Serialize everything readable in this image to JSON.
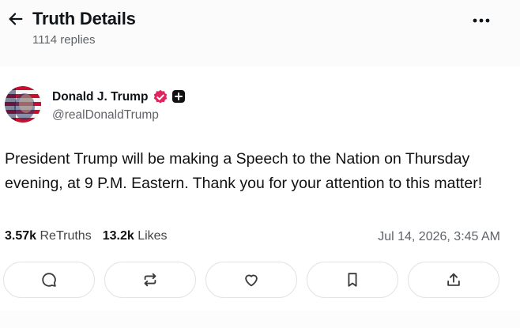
{
  "header": {
    "title": "Truth Details",
    "subtitle": "1114 replies",
    "back_icon": "arrow-left-icon",
    "more_icon": "more-horizontal-icon"
  },
  "post": {
    "author_name": "Donald J. Trump",
    "handle": "@realDonaldTrump",
    "verified_color": "#e0245e",
    "text": "President Trump will be making a Speech to the Nation on Thursday evening, at 9 P.M. Eastern. Thank you for your attention to this matter!",
    "retruths_count": "3.57k",
    "retruths_label": "ReTruths",
    "likes_count": "13.2k",
    "likes_label": "Likes",
    "timestamp": "Jul 14, 2026, 3:45 AM"
  },
  "actions": [
    {
      "icon": "reply-icon"
    },
    {
      "icon": "retruth-icon"
    },
    {
      "icon": "like-icon"
    },
    {
      "icon": "bookmark-icon"
    },
    {
      "icon": "share-icon"
    }
  ]
}
